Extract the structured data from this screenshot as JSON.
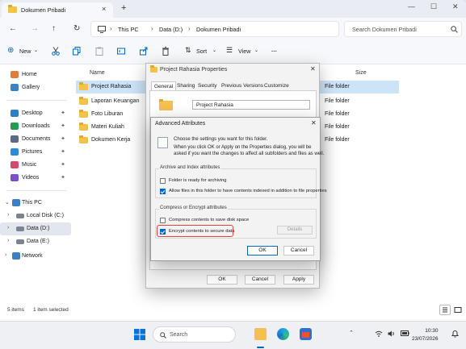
{
  "window": {
    "tab_title": "Dokumen Pribadi",
    "new_tab": "+",
    "tab_close": "×",
    "minimize": "—",
    "maximize": "☐",
    "close": "✕"
  },
  "nav": {
    "back": "←",
    "forward": "→",
    "up": "↑",
    "refresh": "↻"
  },
  "address": {
    "crumbs": [
      "This PC",
      "Data (D:)",
      "Dokumen Pribadi"
    ],
    "separator": "›"
  },
  "search": {
    "placeholder": "Search Dokumen Pribadi"
  },
  "toolbar": {
    "new_label": "New",
    "sort_label": "Sort",
    "view_label": "View",
    "more": "···"
  },
  "sidebar": {
    "quick": [
      {
        "label": "Home",
        "icon": "home-icon",
        "color": "#e07b39"
      },
      {
        "label": "Gallery",
        "icon": "gallery-icon",
        "color": "#3b82c4"
      }
    ],
    "pinned": [
      {
        "label": "Desktop",
        "icon": "desktop-icon",
        "color": "#2b7fc9"
      },
      {
        "label": "Downloads",
        "icon": "downloads-icon",
        "color": "#1f9d55"
      },
      {
        "label": "Documents",
        "icon": "documents-icon",
        "color": "#5b6b86"
      },
      {
        "label": "Pictures",
        "icon": "pictures-icon",
        "color": "#2d8ad8"
      },
      {
        "label": "Music",
        "icon": "music-icon",
        "color": "#d9486a"
      },
      {
        "label": "Videos",
        "icon": "videos-icon",
        "color": "#7a4fd1"
      }
    ],
    "tree": [
      {
        "label": "This PC",
        "icon": "this-pc-icon"
      },
      {
        "label": "Local Disk (C:)",
        "icon": "drive-icon"
      },
      {
        "label": "Data (D:)",
        "icon": "drive-icon"
      },
      {
        "label": "Data (E:)",
        "icon": "drive-icon"
      },
      {
        "label": "Network",
        "icon": "network-icon"
      }
    ],
    "pin_glyph": "📌"
  },
  "filelist": {
    "columns": {
      "name": "Name",
      "size": "Size"
    },
    "rows": [
      {
        "name": "Project Rahasia",
        "type": "File folder"
      },
      {
        "name": "Laporan Keuangan",
        "type": "File folder"
      },
      {
        "name": "Foto Liburan",
        "type": "File folder"
      },
      {
        "name": "Materi Kuliah",
        "type": "File folder"
      },
      {
        "name": "Dokumen Kerja",
        "type": "File folder"
      }
    ]
  },
  "status": {
    "count": "5 items",
    "selected": "1 item selected"
  },
  "properties": {
    "title": "Project Rahasia Properties",
    "tabs": [
      "General",
      "Sharing",
      "Security",
      "Previous Versions",
      "Customize"
    ],
    "name_value": "Project Rahasia",
    "ok": "OK",
    "cancel": "Cancel",
    "apply": "Apply",
    "close": "✕"
  },
  "advanced": {
    "title": "Advanced Attributes",
    "close": "✕",
    "intro": "Choose the settings you want for this folder.",
    "desc_line1": "When you click OK or Apply on the Properties dialog, you will be",
    "desc_line2": "asked if you want the changes to affect all subfolders and files as well.",
    "group1_title": "Archive and Index attributes",
    "archive_label": "Folder is ready for archiving",
    "index_label": "Allow files in this folder to have contents indexed in addition to file properties",
    "group2_title": "Compress or Encrypt attributes",
    "compress_label": "Compress contents to save disk space",
    "encrypt_label": "Encrypt contents to secure data",
    "details": "Details",
    "ok": "OK",
    "cancel": "Cancel",
    "archive_checked": false,
    "index_checked": true,
    "compress_checked": false,
    "encrypt_checked": true
  },
  "taskbar": {
    "search_placeholder": "Search",
    "time": "10:30",
    "date": "23/07/2026"
  },
  "colors": {
    "accent": "#0067c0",
    "highlight": "#e0433a",
    "selection": "#cce4f7"
  }
}
